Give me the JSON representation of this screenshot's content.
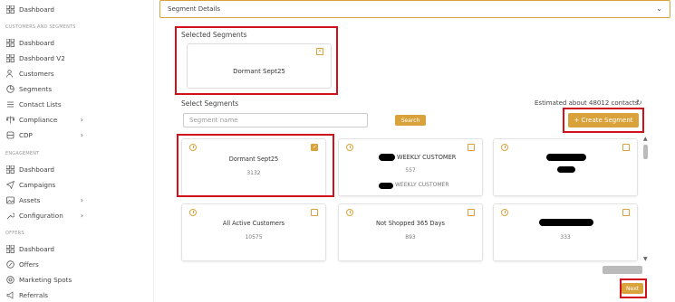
{
  "sidebar": {
    "top_item": "Dashboard",
    "section1": "CUSTOMERS AND SEGMENTS",
    "items1": [
      "Dashboard",
      "Dashboard V2",
      "Customers",
      "Segments",
      "Contact Lists",
      "Compliance",
      "CDP"
    ],
    "section2": "ENGAGEMENT",
    "items2": [
      "Dashboard",
      "Campaigns",
      "Assets",
      "Configuration"
    ],
    "section3": "OFFERS",
    "items3": [
      "Dashboard",
      "Offers",
      "Marketing Spots",
      "Referrals"
    ]
  },
  "header": {
    "title": "Segment Details",
    "chevron": "⌄"
  },
  "selected": {
    "title": "Selected Segments",
    "item": "Dormant Sept25",
    "close": "×"
  },
  "select": {
    "title": "Select Segments",
    "placeholder": "Segment name",
    "search_label": "Search",
    "estimate": "Estimated about 48012 contacts",
    "refresh": "↻",
    "create_label": "+ Create Segment"
  },
  "cards": [
    {
      "title": "Dormant Sept25",
      "value": "3132",
      "checked": true
    },
    {
      "title": "WEEKLY CUSTOMER",
      "value": "557",
      "extra": "WEEKLY CUSTOMER",
      "checked": false
    },
    {
      "title": "",
      "value": "",
      "checked": false
    },
    {
      "title": "All Active Customers",
      "value": "10575",
      "checked": false
    },
    {
      "title": "Not Shopped 365 Days",
      "value": "893",
      "checked": false
    },
    {
      "title": "",
      "value": "333",
      "checked": false
    }
  ],
  "footer": {
    "next_label": "Next"
  },
  "colors": {
    "accent": "#d9a23a",
    "highlight": "#d0101a"
  }
}
